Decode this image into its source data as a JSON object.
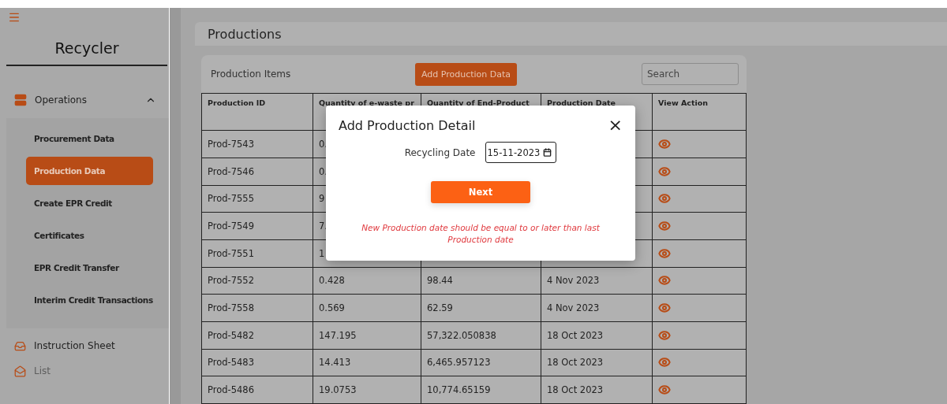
{
  "sidebar": {
    "title": "Recycler",
    "menu": [
      {
        "label": "Operations",
        "kind": "group",
        "expanded": true,
        "children": [
          {
            "label": "Procurement Data",
            "selected": false
          },
          {
            "label": "Production Data",
            "selected": true
          },
          {
            "label": "Create EPR Credit",
            "selected": false
          },
          {
            "label": "Certificates",
            "selected": false
          },
          {
            "label": "EPR Credit Transfer",
            "selected": false
          },
          {
            "label": "Interim Credit Transactions",
            "selected": false
          }
        ]
      },
      {
        "label": "Instruction Sheet",
        "kind": "link",
        "disabled": false
      },
      {
        "label": "List",
        "kind": "link",
        "disabled": true
      }
    ]
  },
  "page_title": "Productions",
  "card": {
    "title": "Production Items",
    "add_button": "Add Production Data",
    "search": {
      "placeholder": "Search"
    },
    "table": {
      "columns": [
        "Production ID",
        "Quantity of e-waste pr",
        "Quantity of End-Product",
        "Production Date",
        "View Action"
      ],
      "rows": [
        {
          "id": "Prod-7543",
          "qty_ewaste": "0."
        },
        {
          "id": "Prod-7546",
          "qty_ewaste": "0."
        },
        {
          "id": "Prod-7555",
          "qty_ewaste": "9"
        },
        {
          "id": "Prod-7549",
          "qty_ewaste": "7."
        },
        {
          "id": "Prod-7551",
          "qty_ewaste": "1"
        },
        {
          "id": "Prod-7552",
          "qty_ewaste": "0.428",
          "qty_end_product": "98.44",
          "date": "4 Nov 2023"
        },
        {
          "id": "Prod-7558",
          "qty_ewaste": "0.569",
          "qty_end_product": "62.59",
          "date": "4 Nov 2023"
        },
        {
          "id": "Prod-5482",
          "qty_ewaste": "147.195",
          "qty_end_product": "57,322.050838",
          "date": "18 Oct 2023"
        },
        {
          "id": "Prod-5483",
          "qty_ewaste": "14.413",
          "qty_end_product": "6,465.957123",
          "date": "18 Oct 2023"
        },
        {
          "id": "Prod-5486",
          "qty_ewaste": "19.0753",
          "qty_end_product": "10,774.65159",
          "date": "18 Oct 2023"
        }
      ]
    }
  },
  "modal": {
    "title": "Add Production Detail",
    "close": "×",
    "field_label": "Recycling Date",
    "field_value": "15-11-2023",
    "button": "Next",
    "error": "New Production date should be equal to or later than last Production date"
  }
}
